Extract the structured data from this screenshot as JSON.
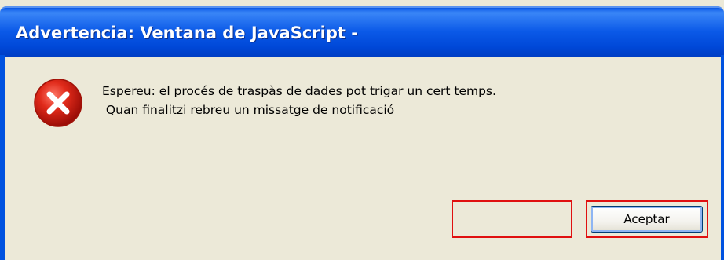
{
  "window": {
    "title": "Advertencia: Ventana de JavaScript -"
  },
  "dialog": {
    "icon": "error-icon",
    "message_line1": "Espereu: el procés de traspàs de dades pot trigar un cert temps.",
    "message_line2": " Quan finalitzi rebreu un missatge de notificació",
    "accept_button_label": "Aceptar"
  },
  "colors": {
    "titlebar": "#0054e3",
    "dialog_bg": "#ece9d8",
    "highlight": "#e01010",
    "error_icon": "#c81414"
  }
}
